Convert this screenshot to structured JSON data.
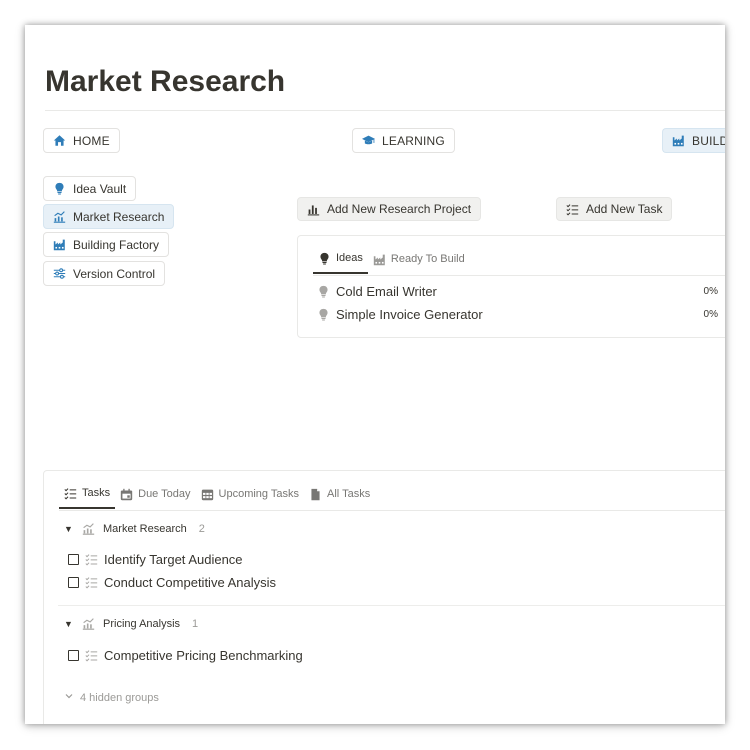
{
  "page": {
    "title": "Market Research"
  },
  "top_nav": [
    {
      "label": "HOME",
      "icon": "home-icon"
    },
    {
      "label": "LEARNING",
      "icon": "graduation-cap-icon"
    },
    {
      "label": "BUILDI",
      "icon": "factory-icon"
    }
  ],
  "sidebar": [
    {
      "label": "Idea Vault",
      "icon": "lightbulb-icon"
    },
    {
      "label": "Market Research",
      "icon": "chart-icon"
    },
    {
      "label": "Building Factory",
      "icon": "factory-icon"
    },
    {
      "label": "Version Control",
      "icon": "sliders-icon"
    }
  ],
  "actions": {
    "add_research": "Add New Research Project",
    "add_task": "Add New Task"
  },
  "ideas_view": {
    "tabs": [
      {
        "label": "Ideas",
        "active": true
      },
      {
        "label": "Ready To Build",
        "active": false
      }
    ],
    "rows": [
      {
        "name": "Cold Email Writer",
        "progress": "0%"
      },
      {
        "name": "Simple Invoice Generator",
        "progress": "0%"
      }
    ]
  },
  "tasks_view": {
    "tabs": [
      {
        "label": "Tasks",
        "icon": "checklist-icon",
        "active": true
      },
      {
        "label": "Due Today",
        "icon": "calendar-icon",
        "active": false
      },
      {
        "label": "Upcoming Tasks",
        "icon": "calendar-grid-icon",
        "active": false
      },
      {
        "label": "All Tasks",
        "icon": "document-icon",
        "active": false
      }
    ],
    "groups": [
      {
        "name": "Market Research",
        "count": "2",
        "tasks": [
          "Identify Target Audience",
          "Conduct Competitive Analysis"
        ]
      },
      {
        "name": "Pricing Analysis",
        "count": "1",
        "tasks": [
          "Competitive Pricing Benchmarking"
        ]
      }
    ],
    "hidden_groups": "4 hidden groups"
  },
  "colors": {
    "accent_icon": "#2f7db8",
    "active_bg": "#e7f0f7",
    "text": "#37352f",
    "muted": "#9b9a97"
  }
}
